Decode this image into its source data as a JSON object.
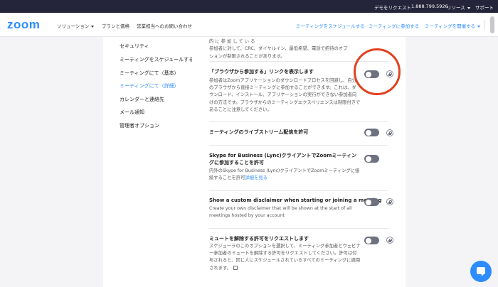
{
  "topbar": {
    "demo_request": "デモをリクエスト",
    "phone": "1.888.799.5926",
    "resources": "リソース",
    "support": "サポート"
  },
  "header": {
    "logo": "zoom",
    "nav_solutions": "ソリューション",
    "nav_pricing": "プランと価格",
    "nav_contact_sales": "営業担当へのお問い合わせ",
    "schedule_meeting": "ミーティングをスケジュールする",
    "join_meeting": "ミーティングに参加する",
    "host_meeting": "ミーティングを開催する"
  },
  "sidebar": {
    "items": [
      {
        "label": "セキュリティ"
      },
      {
        "label": "ミーティングをスケジュールする"
      },
      {
        "label": "ミーティングにて（基本）"
      },
      {
        "label": "ミーティングにて（詳細）"
      },
      {
        "label": "カレンダーと連絡先"
      },
      {
        "label": "メール通知"
      },
      {
        "label": "管理者オプション"
      }
    ]
  },
  "main": {
    "top_partial_lines": [
      "ー の 組 織 と ス ケ ジ ュ ー ル す る と 、 こ れ ら の 組 織 か ら 自 動 的 に 参 加 し て い る",
      "参加者に対して、CRC、ダイヤルイン、最低希望、電話で招待のオプ",
      "ションが制限されることがあります。"
    ],
    "browser_join": {
      "title": "「ブラウザから参加する」リンクを表示します",
      "desc": "参加者はZoomアプリケーションのダウンロードプロセスを回避し、自分のブラウザから直接ミーティングに参加することができます。これは、ダウンロード、インストール、アプリケーションの実行ができない参加者向けの方法です。ブラウザからのミーティングエクスペリエンスは制限付きであることに注意してください。"
    },
    "livestream": {
      "title": "ミーティングのライブストリーム配信を許可"
    },
    "skype": {
      "title": "Skype for Business (Lync)クライアントでZoomミーティングに参加することを許可",
      "desc": "内外のSkype for Business (Lync)クライアントでZoomミーティングに接続することを許可",
      "link": "詳細を見る"
    },
    "disclaimer": {
      "title": "Show a custom disclaimer when starting or joining a meeting",
      "desc": "Create your own disclaimer that will be shown at the start of all meetings hosted by your account"
    },
    "unmute": {
      "title": "ミュートを解除する許可をリクエストします",
      "desc": "スケジューラのこのオプションを選択して、ミーティング参加者とウェビナー参加者のミュートを解除する許可をリクエストしてください。許可は付与されると、同じ人にスケジュールされているすべてのミーティングに適用されます。"
    }
  },
  "toggles": {
    "browser_join": false,
    "livestream": false,
    "skype": false,
    "disclaimer": false,
    "unmute": false
  },
  "colors": {
    "brand": "#2d8cff",
    "highlight_circle": "#e2411f",
    "toggle_off": "#6e7180"
  },
  "icons": {
    "lock": "lock-icon",
    "chat": "chat-bubble-icon"
  }
}
